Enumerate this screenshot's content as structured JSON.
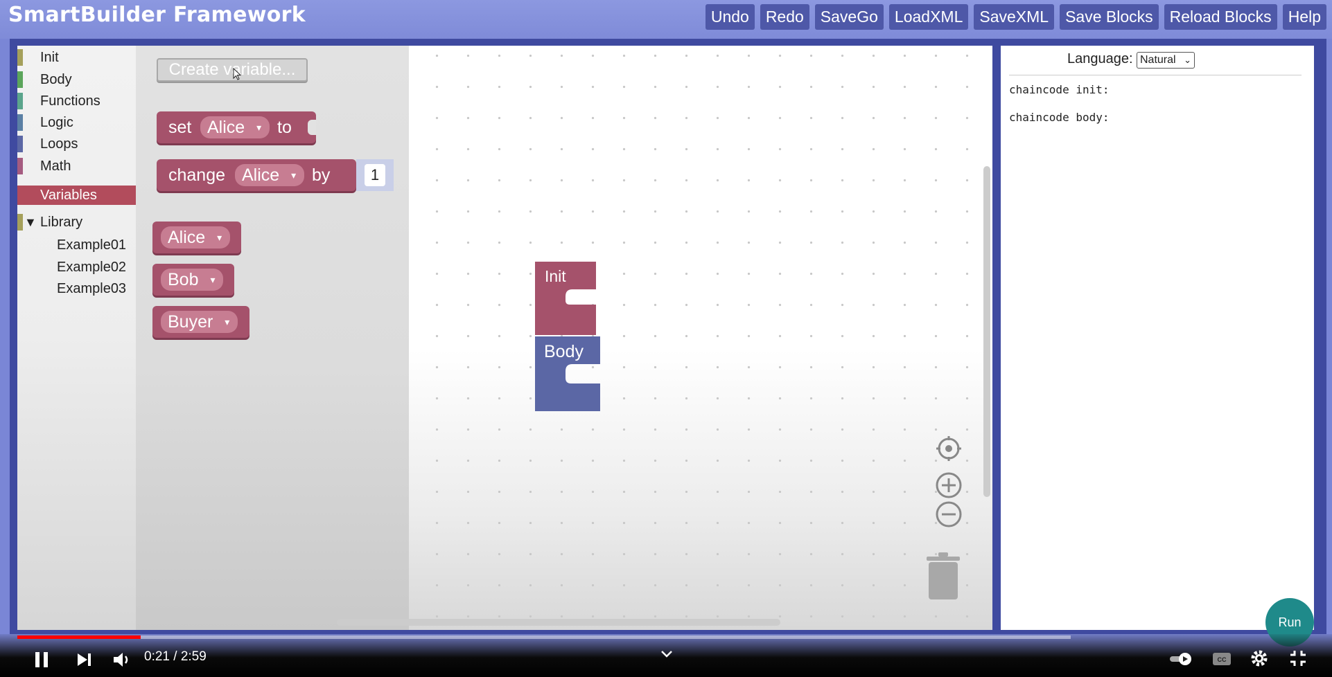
{
  "app": {
    "title": "SmartBuilder Framework"
  },
  "toolbar": {
    "buttons": [
      "Undo",
      "Redo",
      "SaveGo",
      "LoadXML",
      "SaveXML",
      "Save Blocks",
      "Reload Blocks",
      "Help"
    ]
  },
  "toolbox": {
    "categories": [
      {
        "label": "Init",
        "color": "#a5a05b"
      },
      {
        "label": "Body",
        "color": "#5ba55b"
      },
      {
        "label": "Functions",
        "color": "#5ba58c"
      },
      {
        "label": "Logic",
        "color": "#5b80a5"
      },
      {
        "label": "Loops",
        "color": "#5b67a5"
      },
      {
        "label": "Math",
        "color": "#a55b80"
      }
    ],
    "selected": {
      "label": "Variables",
      "color": "#b24c5c"
    },
    "library": {
      "label": "Library",
      "toggle": "▼",
      "items": [
        "Example01",
        "Example02",
        "Example03"
      ]
    }
  },
  "flyout": {
    "create_variable": "Create variable...",
    "set_block": {
      "prefix": "set",
      "variable": "Alice",
      "suffix": "to"
    },
    "change_block": {
      "prefix": "change",
      "variable": "Alice",
      "middle": "by",
      "value": "1"
    },
    "variables": [
      "Alice",
      "Bob",
      "Buyer"
    ],
    "dropdown_arrow": "▾"
  },
  "workspace": {
    "init_block": {
      "label": "Init",
      "color": "#a5526b"
    },
    "body_block": {
      "label": "Body",
      "color": "#5b67a5"
    },
    "controls": [
      "recenter-icon",
      "zoom-in-icon",
      "zoom-out-icon",
      "trash-icon"
    ]
  },
  "code_panel": {
    "language_label": "Language:",
    "language_value": "Natural",
    "lines": [
      "chaincode init:",
      "chaincode body:"
    ]
  },
  "run_button": "Run",
  "video": {
    "time": "0:21 / 2:59",
    "progress": 0.117
  }
}
